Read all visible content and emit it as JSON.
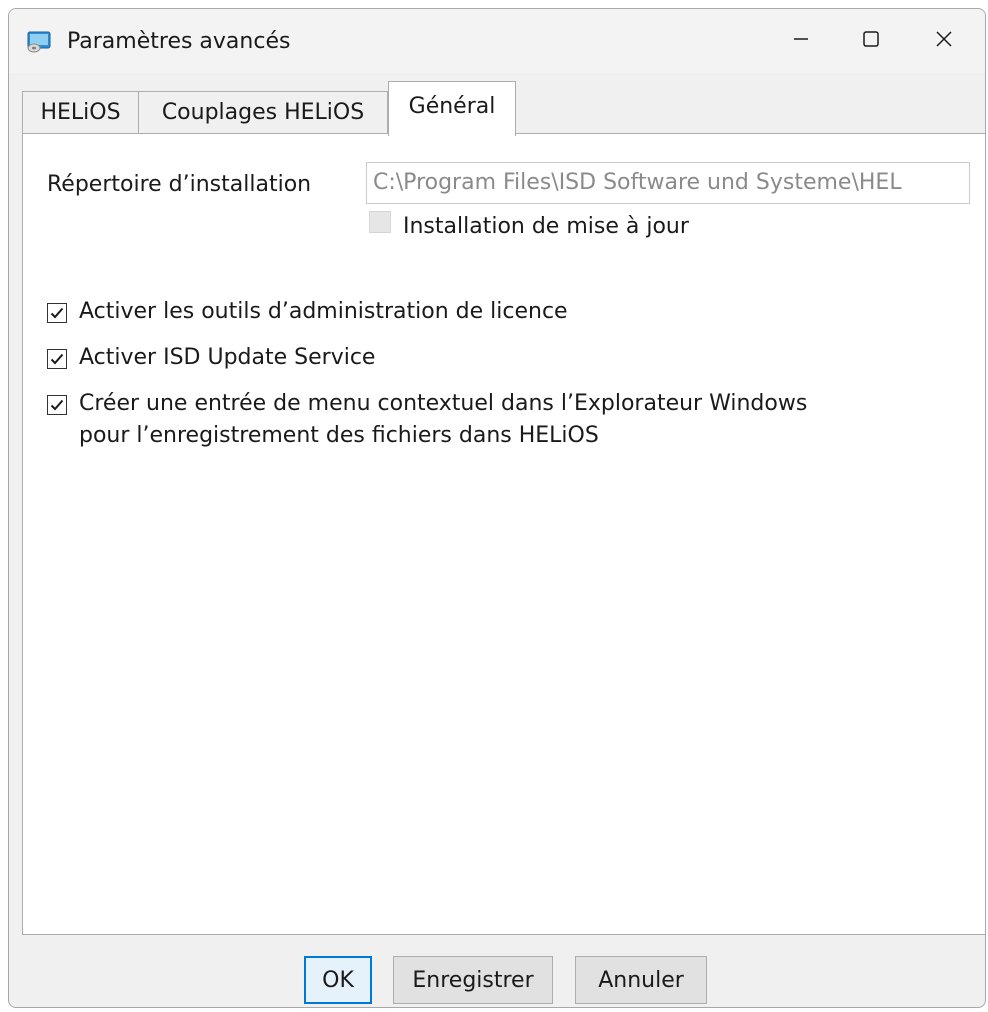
{
  "window": {
    "title": "Paramètres avancés",
    "icon": "app-icon"
  },
  "tabs": [
    {
      "label": "HELiOS",
      "selected": false
    },
    {
      "label": "Couplages HELiOS",
      "selected": false
    },
    {
      "label": "Général",
      "selected": true
    }
  ],
  "general": {
    "install_dir_label": "Répertoire d’installation",
    "install_dir_value": "C:\\Program Files\\ISD Software und Systeme\\HEL",
    "update_install_label": "Installation de mise à jour",
    "update_install_checked": false,
    "options": [
      {
        "label": "Activer les outils d’administration de licence",
        "checked": true
      },
      {
        "label": "Activer ISD Update Service",
        "checked": true
      },
      {
        "label": "Créer une entrée de menu contextuel dans l’Explorateur Windows",
        "label_line2": "pour l’enregistrement des fichiers dans HELiOS",
        "checked": true
      }
    ]
  },
  "buttons": {
    "ok": "OK",
    "save": "Enregistrer",
    "cancel": "Annuler"
  },
  "colors": {
    "accent": "#0078d7",
    "window_bg": "#f0f0f0",
    "panel_bg": "#ffffff"
  }
}
